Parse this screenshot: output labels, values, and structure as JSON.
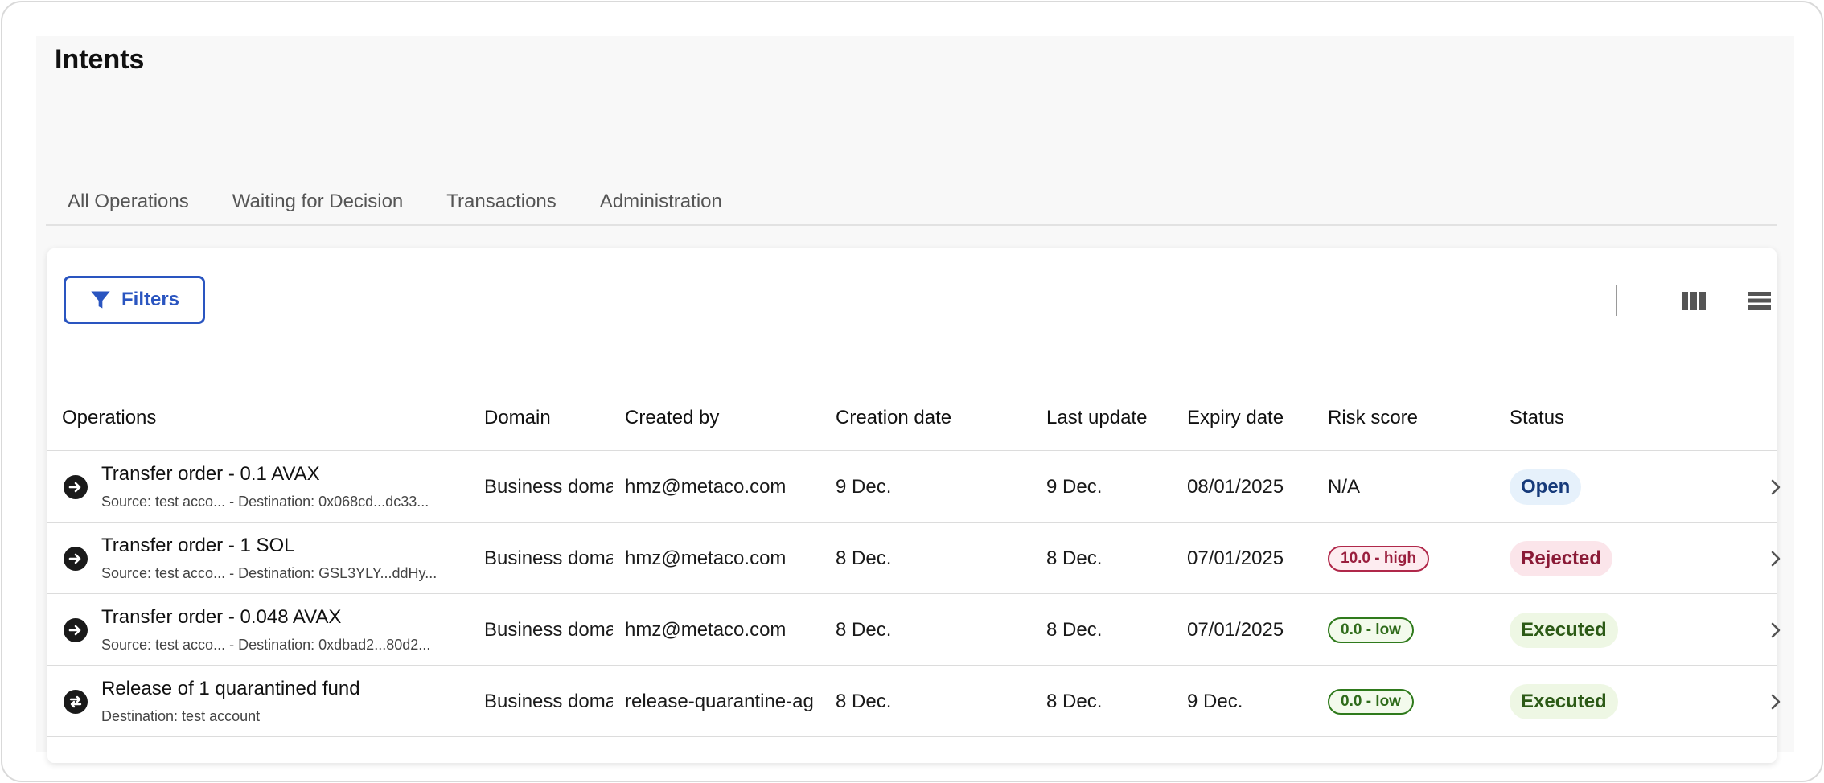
{
  "page": {
    "title": "Intents"
  },
  "tabs": [
    {
      "label": "All Operations"
    },
    {
      "label": "Waiting for Decision"
    },
    {
      "label": "Transactions"
    },
    {
      "label": "Administration"
    }
  ],
  "toolbar": {
    "filters_label": "Filters"
  },
  "table": {
    "columns": {
      "operations": "Operations",
      "domain": "Domain",
      "created_by": "Created by",
      "creation_date": "Creation date",
      "last_update": "Last update",
      "expiry_date": "Expiry date",
      "risk_score": "Risk score",
      "status": "Status"
    },
    "rows": [
      {
        "title": "Transfer order - 0.1 AVAX",
        "subtitle": "Source: test acco...   - Destination: 0x068cd...dc33...",
        "icon": "arrow-right-circle-icon",
        "domain": "Business doma",
        "created_by": "hmz@metaco.com",
        "creation_date": "9 Dec.",
        "last_update": "9 Dec.",
        "expiry_date": "08/01/2025",
        "risk_text": "N/A",
        "status": "Open"
      },
      {
        "title": "Transfer order - 1 SOL",
        "subtitle": "Source: test acco...   - Destination: GSL3YLY...ddHy...",
        "icon": "arrow-right-circle-icon",
        "domain": "Business doma",
        "created_by": "hmz@metaco.com",
        "creation_date": "8 Dec.",
        "last_update": "8 Dec.",
        "expiry_date": "07/01/2025",
        "risk_badge": "10.0 - high",
        "status": "Rejected"
      },
      {
        "title": "Transfer order - 0.048 AVAX",
        "subtitle": "Source: test acco...   - Destination: 0xdbad2...80d2...",
        "icon": "arrow-right-circle-icon",
        "domain": "Business doma",
        "created_by": "hmz@metaco.com",
        "creation_date": "8 Dec.",
        "last_update": "8 Dec.",
        "expiry_date": "07/01/2025",
        "risk_badge": "0.0 - low",
        "status": "Executed"
      },
      {
        "title": "Release of 1 quarantined fund",
        "subtitle": "Destination: test account",
        "icon": "release-circle-icon",
        "domain": "Business doma",
        "created_by": "release-quarantine-ag",
        "creation_date": "8 Dec.",
        "last_update": "8 Dec.",
        "expiry_date": "9 Dec.",
        "risk_badge": "0.0 - low",
        "status": "Executed"
      }
    ]
  },
  "colors": {
    "accent": "#2a55c0",
    "open_bg": "#e6f1fb",
    "open_fg": "#163a7a",
    "rejected_bg": "#fbe5ea",
    "rejected_fg": "#8a1a36",
    "executed_bg": "#eef7e4",
    "executed_fg": "#2c5a16",
    "high_border": "#b0284a",
    "high_fg": "#9a1f3e",
    "high_bg": "#fdecf0",
    "low_border": "#2f7a1c",
    "low_fg": "#2f6b1a",
    "low_bg": "#f3faec"
  }
}
